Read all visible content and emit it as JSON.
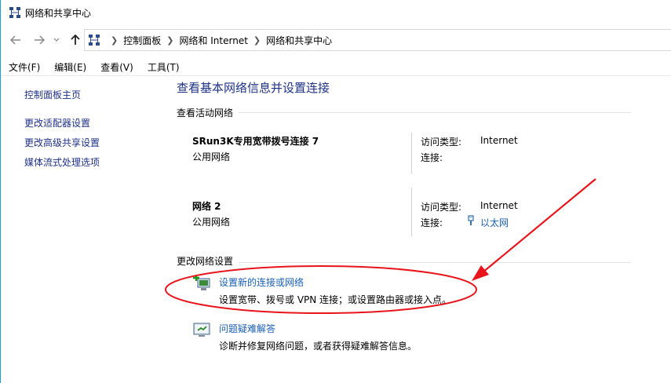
{
  "window": {
    "title": "网络和共享中心"
  },
  "address_bar": {
    "breadcrumbs": [
      "控制面板",
      "网络和 Internet",
      "网络和共享中心"
    ]
  },
  "menu": {
    "items": [
      "文件(F)",
      "编辑(E)",
      "查看(V)",
      "工具(T)"
    ]
  },
  "sidebar": {
    "items": [
      {
        "label": "控制面板主页"
      },
      {
        "label": "更改适配器设置"
      },
      {
        "label": "更改高级共享设置"
      },
      {
        "label": "媒体流式处理选项"
      }
    ]
  },
  "main": {
    "title": "查看基本网络信息并设置连接",
    "active_networks_heading": "查看活动网络",
    "networks": [
      {
        "name": "SRun3K专用宽带拨号连接 7",
        "type": "公用网络",
        "access_label": "访问类型:",
        "access_value": "Internet",
        "conn_label": "连接:",
        "conn_value": ""
      },
      {
        "name": "网络 2",
        "type": "公用网络",
        "access_label": "访问类型:",
        "access_value": "Internet",
        "conn_label": "连接:",
        "conn_value": "以太网"
      }
    ],
    "change_settings_heading": "更改网络设置",
    "tasks": [
      {
        "title": "设置新的连接或网络",
        "desc": "设置宽带、拨号或 VPN 连接；或设置路由器或接入点。"
      },
      {
        "title": "问题疑难解答",
        "desc": "诊断并修复网络问题，或者获得疑难解答信息。"
      }
    ]
  },
  "colors": {
    "link": "#1a5fb4",
    "nav_link": "#1e3287",
    "annotation": "#e8141c",
    "window_border": "#1ba1e2"
  },
  "icons": [
    "network-center-icon",
    "back-arrow-icon",
    "forward-arrow-icon",
    "recent-chevron-icon",
    "up-arrow-icon",
    "ethernet-icon",
    "new-connection-icon",
    "troubleshoot-icon"
  ]
}
